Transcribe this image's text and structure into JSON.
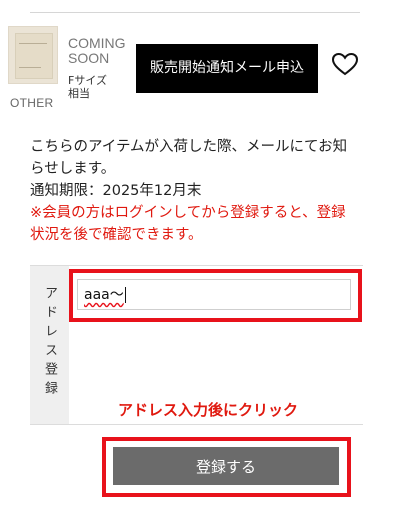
{
  "product": {
    "thumbnail_icon": "product-box-image",
    "category": "OTHER",
    "status": "COMING\nSOON",
    "size_line1": "Fサイズ",
    "size_line2": "相当"
  },
  "notify_button_label": "販売開始通知メール申込",
  "favorite_icon": "heart-outline-icon",
  "message": {
    "line1": "こちらのアイテムが入荷した際、メールにてお知らせします。",
    "deadline": "通知期限：2025年12月末",
    "warning": "※会員の方はログインしてから登録すると、登録状況を後で確認できます。"
  },
  "form": {
    "address_label": "アドレス登録",
    "address_value": "aaa〜"
  },
  "annotation_text": "アドレス入力後にクリック",
  "submit_label": "登録する",
  "colors": {
    "highlight_red": "#e8121b",
    "warning_red": "#e0190f",
    "notify_button_bg": "#000000",
    "submit_button_bg": "#6b6b6b"
  }
}
